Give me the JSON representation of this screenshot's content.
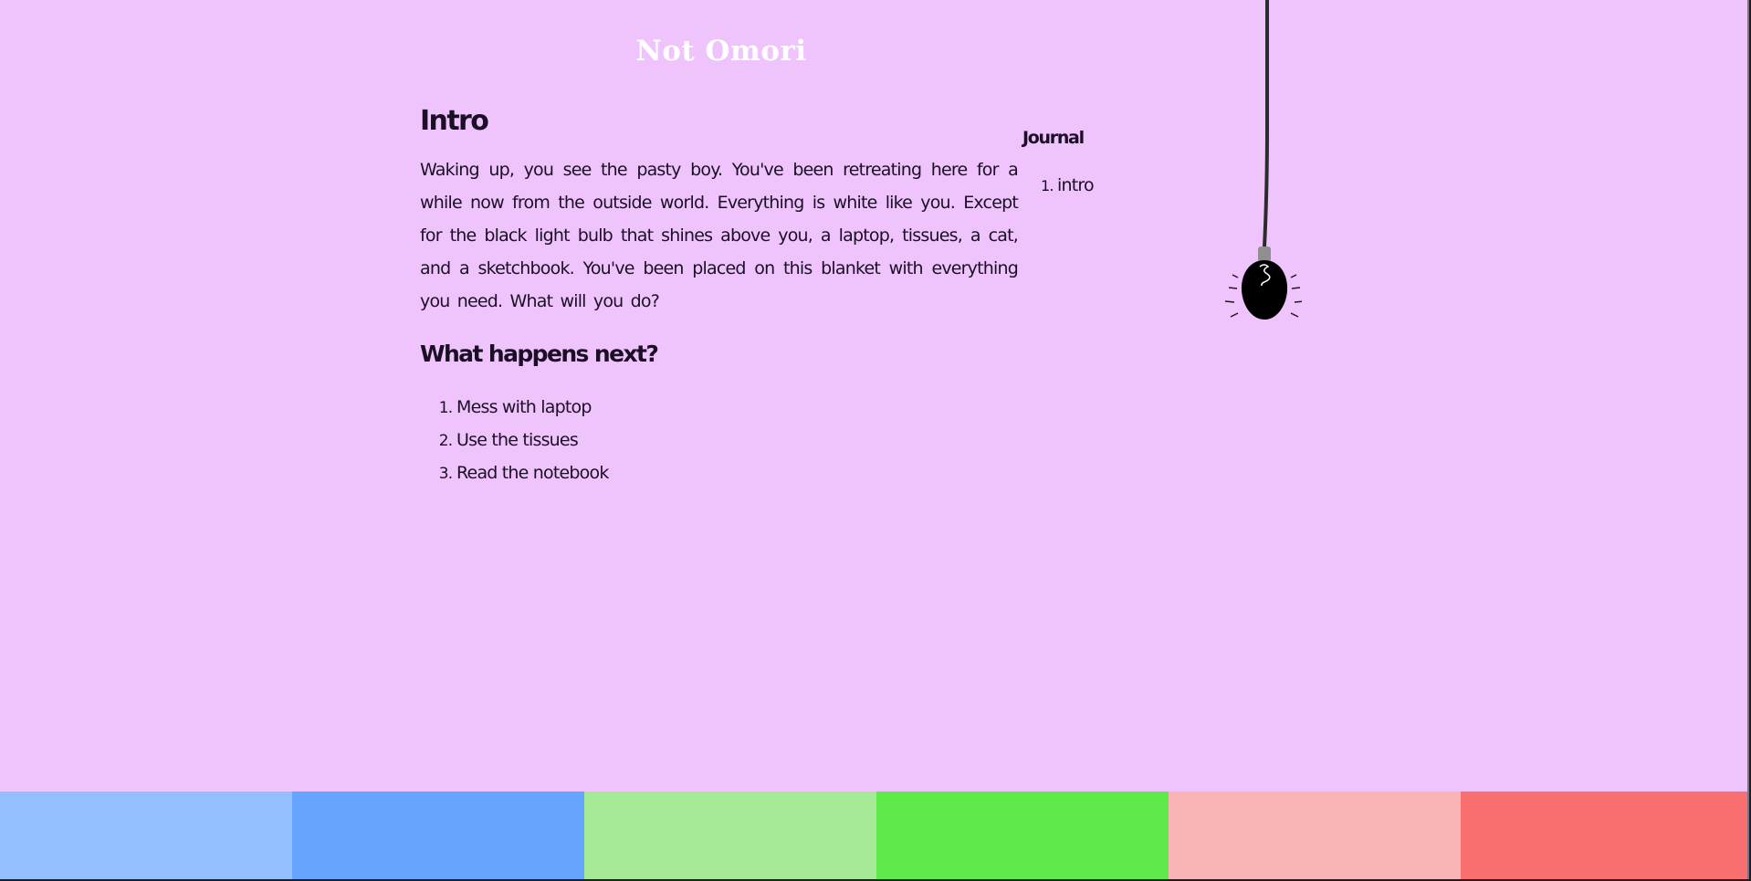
{
  "site": {
    "title": "Not Omori"
  },
  "main": {
    "intro_heading": "Intro",
    "intro_text": "Waking up, you see the pasty boy. You've been retreating here for a while now from the outside world. Everything is white like you. Except for the black light bulb that shines above you, a laptop, tissues, a cat, and a sketchbook. You've been placed on this blanket with everything you need. What will you do?",
    "next_heading": "What happens next?",
    "choices": [
      {
        "label": "Mess with laptop"
      },
      {
        "label": "Use the tissues"
      },
      {
        "label": "Read the notebook"
      }
    ]
  },
  "journal": {
    "title": "Journal",
    "entries": [
      {
        "label": "intro"
      }
    ]
  },
  "icons": {
    "bulb": "hanging-light-bulb-icon"
  },
  "colors": {
    "background": "#efc3fc",
    "title": "#ffffff",
    "strip": [
      "#93bffd",
      "#65a5fd",
      "#a5eb97",
      "#5eea49",
      "#f9b3b5",
      "#f96e6f"
    ]
  }
}
